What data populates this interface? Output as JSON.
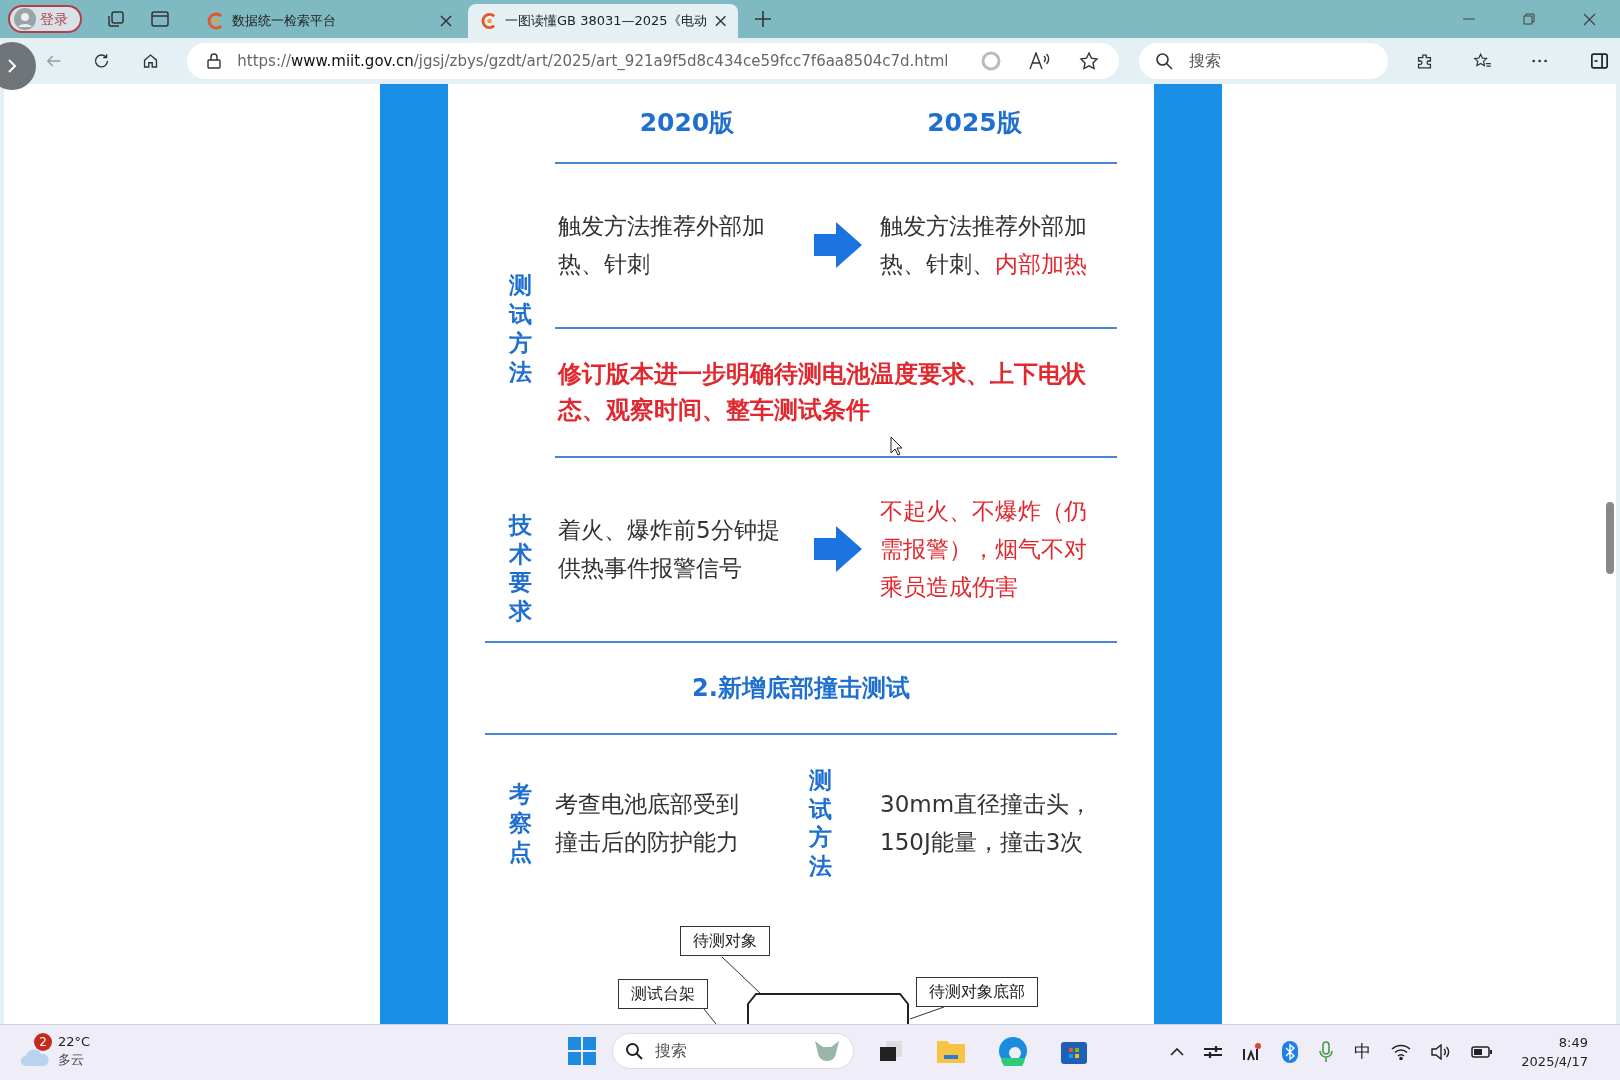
{
  "browser": {
    "profile_label": "登录",
    "tabs": [
      {
        "title": "数据统一检索平台",
        "selected": false
      },
      {
        "title": "一图读懂GB 38031—2025《电动",
        "selected": true
      }
    ],
    "url": {
      "prefix": "https://",
      "host": "www.miit.gov.cn",
      "path": "/jgsj/zbys/gzdt/art/2025/art_921a9f5d8c434ce59fcc7f6aa8504c7d.html"
    },
    "search": {
      "placeholder": "搜索"
    }
  },
  "infographic": {
    "column_headers": [
      "2020版",
      "2025版"
    ],
    "sections": [
      {
        "kind": "compare",
        "label": "测试方法",
        "rows": [
          {
            "kind": "compare",
            "before": [
              {
                "text": "触发方法推荐外部加热、针刺",
                "highlight": false
              }
            ],
            "after": [
              {
                "text": "触发方法推荐外部加热、针刺、",
                "highlight": false
              },
              {
                "text": "内部加热",
                "highlight": true
              }
            ]
          },
          {
            "kind": "note",
            "text": "修订版本进一步明确待测电池温度要求、上下电状态、观察时间、整车测试条件"
          }
        ]
      },
      {
        "kind": "compare",
        "label": "技术要求",
        "rows": [
          {
            "kind": "compare",
            "before": [
              {
                "text": "着火、爆炸前5分钟提供热事件报警信号",
                "highlight": false
              }
            ],
            "after": [
              {
                "text": "不起火、不爆炸（仍需报警），烟气不对乘员造成伤害",
                "highlight": true
              }
            ]
          }
        ]
      },
      {
        "kind": "heading",
        "text": "2.新增底部撞击测试"
      },
      {
        "kind": "pair",
        "label": "考察点",
        "text": "考查电池底部受到撞击后的防护能力",
        "label_2": "测试方法",
        "text_2": "30mm直径撞击头，150J能量，撞击3次"
      }
    ],
    "diagram_labels": [
      "待测对象",
      "测试台架",
      "待测对象底部"
    ]
  },
  "taskbar": {
    "weather": {
      "badge": "2",
      "temperature": "22°C",
      "condition": "多云"
    },
    "search": {
      "placeholder": "搜索"
    },
    "input_method": "中",
    "time": "8:49",
    "date": "2025/4/17"
  }
}
